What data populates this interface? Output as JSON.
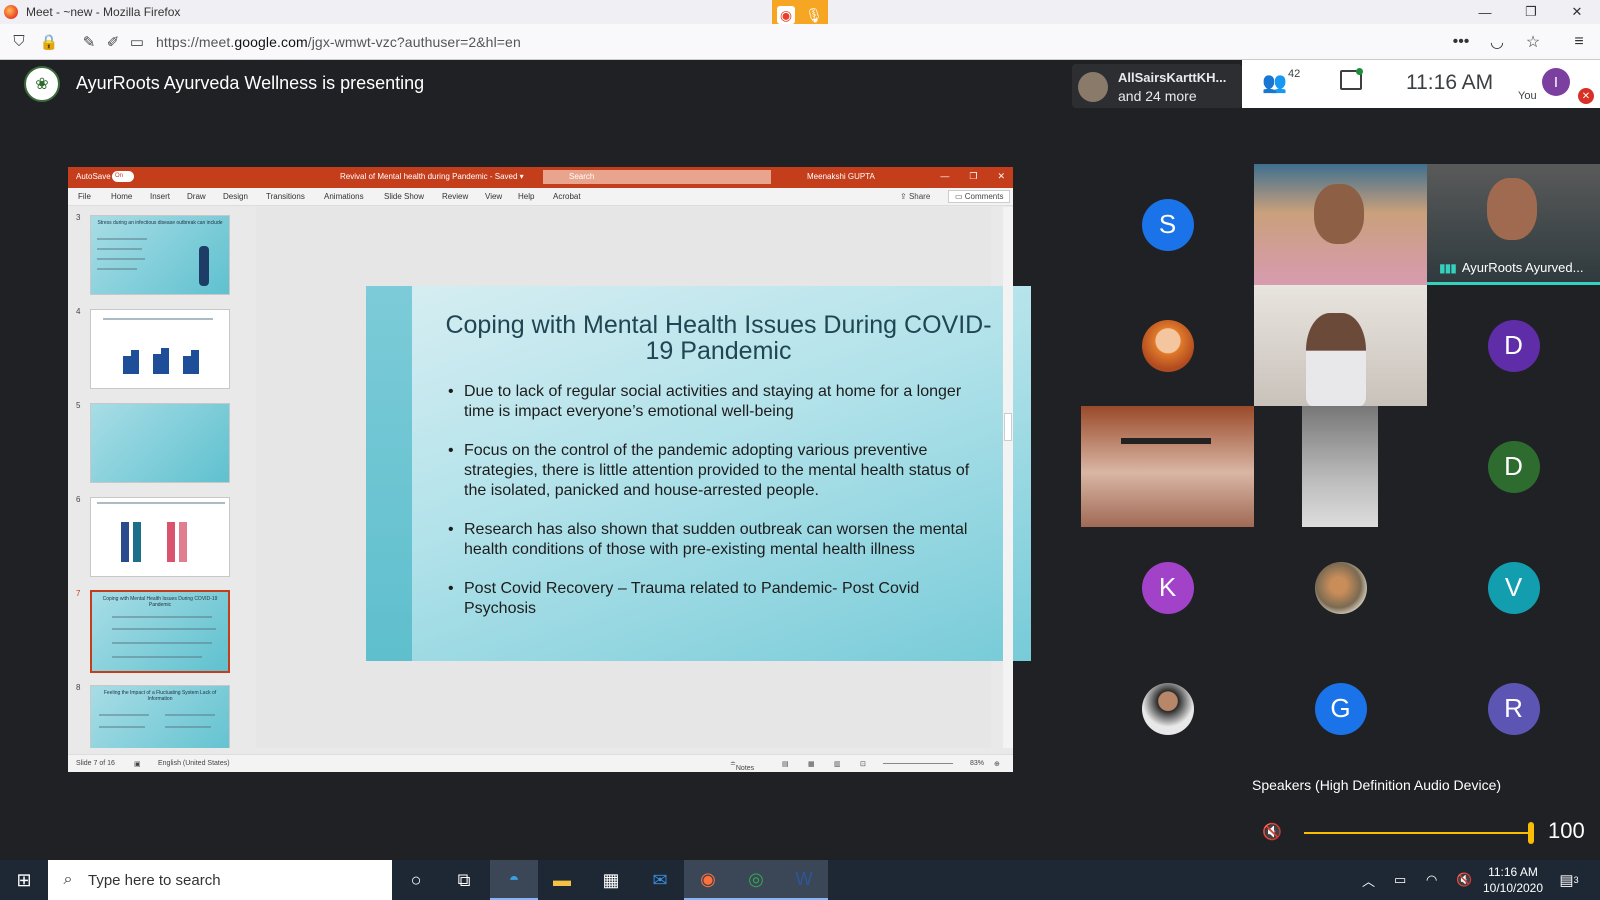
{
  "browser": {
    "title": "Meet - ~new - Mozilla Firefox",
    "url_prefix": "https://meet.",
    "url_domain": "google.com",
    "url_rest": "/jgx-wmwt-vzc?authuser=2&hl=en"
  },
  "meet": {
    "presenting": "AyurRoots Ayurveda Wellness is presenting",
    "participants_chip_line1": "AllSairsKarttKH...",
    "participants_chip_line2": "and 24 more",
    "people_count": "42",
    "time": "11:16 AM",
    "you_label": "You",
    "you_initial": "I"
  },
  "ppt": {
    "autosave": "AutoSave",
    "autosave_state": "On",
    "doc_title": "Revival of Mental health during Pandemic  -  Saved  ▾",
    "search_placeholder": "Search",
    "user": "Meenakshi GUPTA",
    "ribbon_tabs": [
      "File",
      "Home",
      "Insert",
      "Draw",
      "Design",
      "Transitions",
      "Animations",
      "Slide Show",
      "Review",
      "View",
      "Help",
      "Acrobat"
    ],
    "share": "Share",
    "comments": "Comments",
    "status_slide": "Slide 7 of 16",
    "status_lang": "English (United States)",
    "status_notes": "Notes",
    "status_zoom": "83%",
    "thumb_numbers": [
      "3",
      "4",
      "5",
      "6",
      "7",
      "8"
    ],
    "thumb_titles": [
      "Stress during an infectious disease outbreak can include",
      "",
      "",
      "",
      "Coping with Mental Health Issues During COVID-19 Pandemic",
      "Feeling the Impact of a Fluctuating System Lack of Information"
    ]
  },
  "slide": {
    "title": "Coping with Mental Health Issues During COVID-19 Pandemic",
    "bullets": [
      "Due to lack of regular social activities and staying at home for a longer time is impact everyone’s emotional well-being",
      "Focus on the control of the pandemic adopting various preventive strategies, there is little attention provided to the mental health status of the isolated, panicked and house-arrested people.",
      "Research has also shown that sudden outbreak can worsen the mental health conditions of those with pre-existing mental health illness",
      "Post Covid Recovery –  Trauma related to Pandemic- Post Covid Psychosis"
    ]
  },
  "tiles": {
    "s": "S",
    "d1": "D",
    "d2": "D",
    "k": "K",
    "v": "V",
    "g": "G",
    "r": "R",
    "active_speaker": "AyurRoots Ayurved..."
  },
  "tile_colors": {
    "s": "#1a73e8",
    "d1": "#5f2da8",
    "d2": "#2e6b2f",
    "k": "#a142c8",
    "v": "#129eaf",
    "g": "#1a73e8",
    "r": "#5c55b4"
  },
  "speakers_popup": {
    "title": "Speakers (High Definition Audio Device)",
    "volume": "100"
  },
  "taskbar": {
    "search_placeholder": "Type here to search",
    "time": "11:16 AM",
    "date": "10/10/2020",
    "notifications": "3"
  }
}
